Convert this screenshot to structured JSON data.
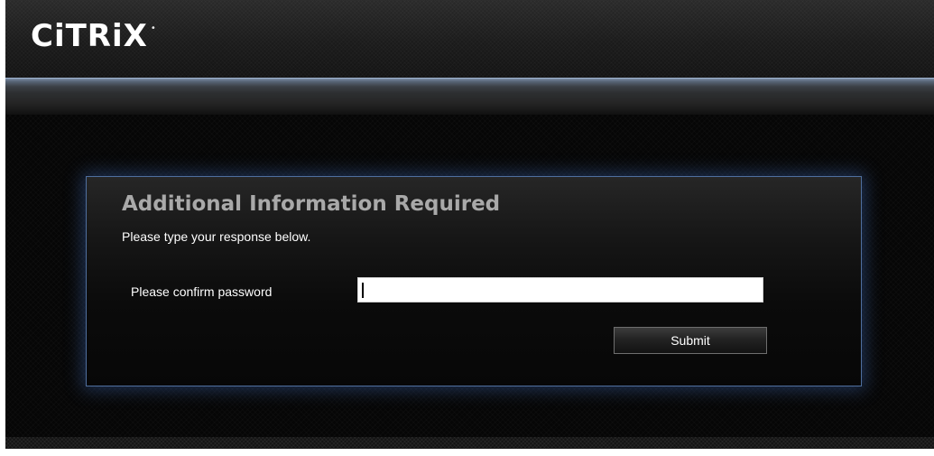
{
  "header": {
    "logo_text": "CiTRiX",
    "logo_mark": "•"
  },
  "dialog": {
    "title": "Additional Information Required",
    "subtitle": "Please type your response below.",
    "field_label": "Please confirm password",
    "password_value": "",
    "submit_label": "Submit"
  },
  "colors": {
    "accent_border": "#4f6f9e",
    "title": "#a9a9a9"
  }
}
